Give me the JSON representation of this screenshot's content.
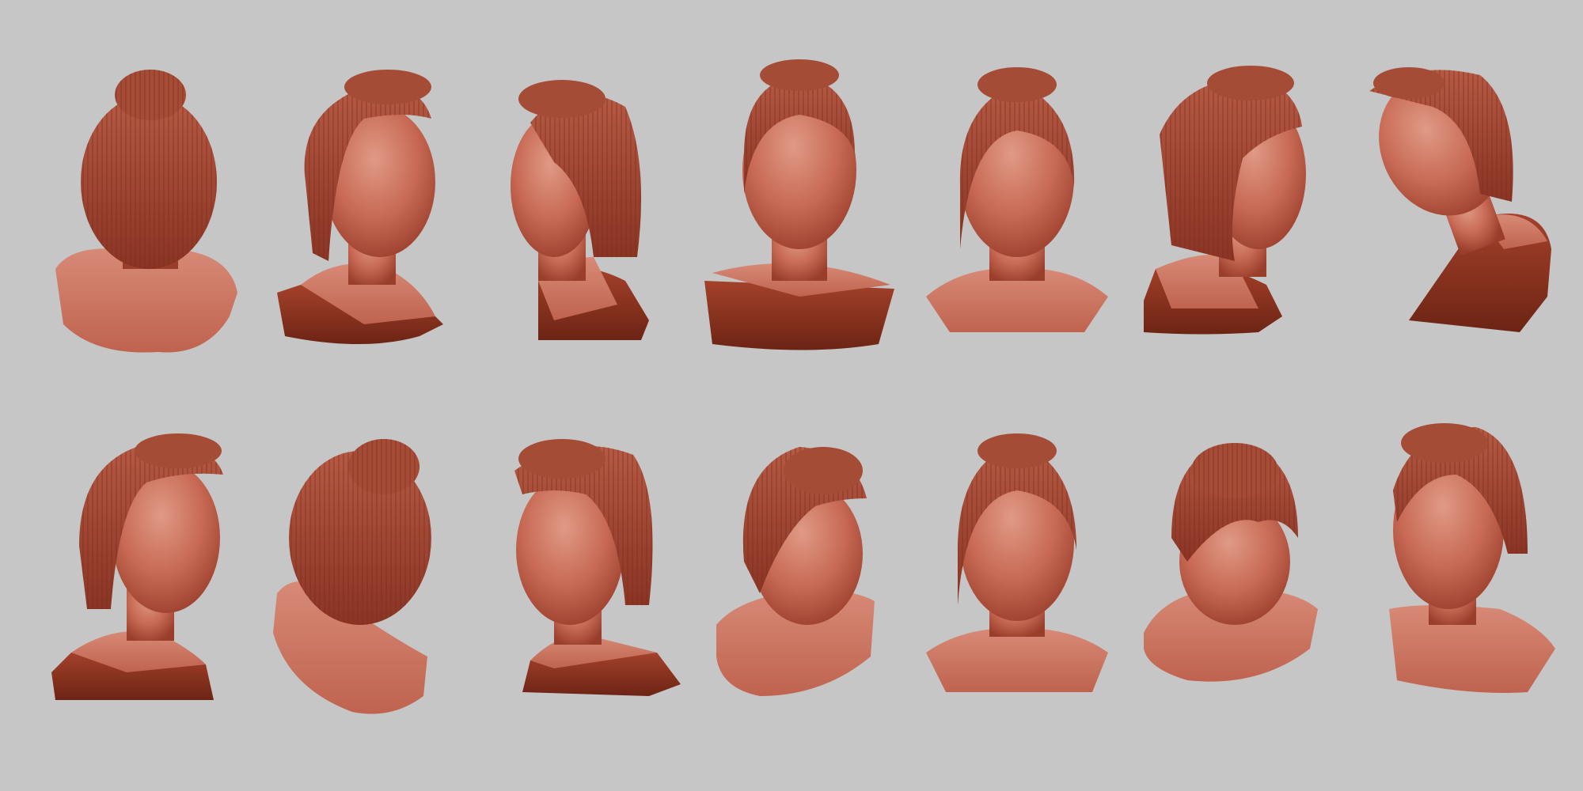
{
  "scene": {
    "background_color": "#c6c6c6",
    "material_color": "#c4644f",
    "material_shadow_color": "#7e2a1a",
    "material_highlight_color": "#dc8c78"
  },
  "busts": [
    {
      "row": 1,
      "view": "back",
      "base": "rounded"
    },
    {
      "row": 1,
      "view": "three-quarter-right",
      "base": "cut"
    },
    {
      "row": 1,
      "view": "profile-left-back",
      "base": "cut"
    },
    {
      "row": 1,
      "view": "front-low-angle",
      "base": "box"
    },
    {
      "row": 1,
      "view": "front",
      "base": "rounded"
    },
    {
      "row": 1,
      "view": "three-quarter-back-right",
      "base": "cut"
    },
    {
      "row": 1,
      "view": "tilted-up-left",
      "base": "cut"
    },
    {
      "row": 2,
      "view": "three-quarter-right",
      "base": "cut"
    },
    {
      "row": 2,
      "view": "back-tilted",
      "base": "rounded"
    },
    {
      "row": 2,
      "view": "three-quarter-left",
      "base": "cut"
    },
    {
      "row": 2,
      "view": "top-down-right",
      "base": "rounded"
    },
    {
      "row": 2,
      "view": "front",
      "base": "rounded"
    },
    {
      "row": 2,
      "view": "top-down",
      "base": "rounded"
    },
    {
      "row": 2,
      "view": "three-quarter-left",
      "base": "cut"
    }
  ]
}
